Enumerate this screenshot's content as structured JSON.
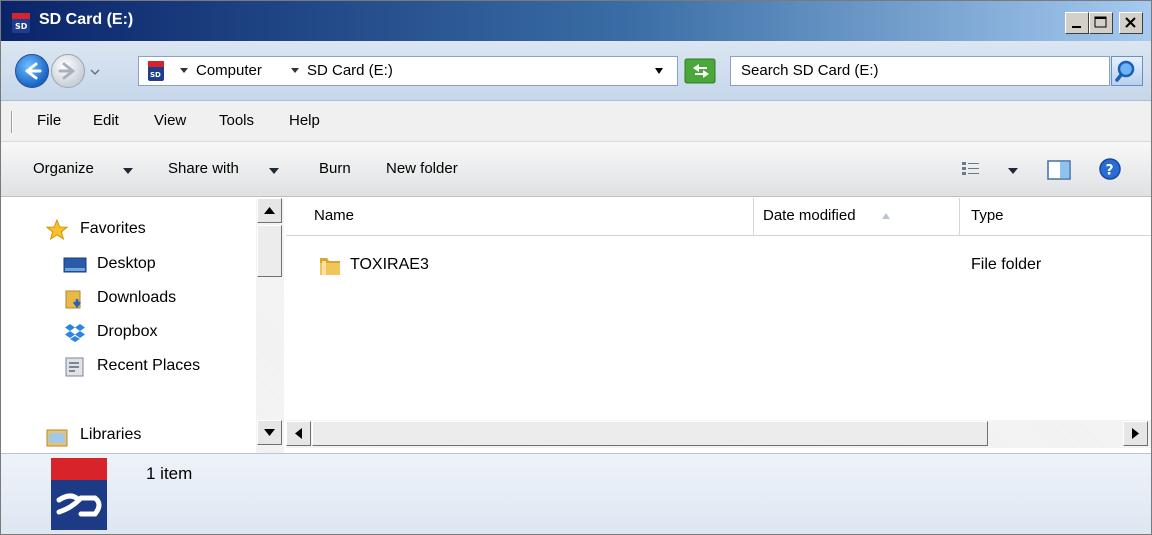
{
  "window": {
    "title": "SD Card (E:)"
  },
  "address_bar": {
    "breadcrumbs": [
      "Computer",
      "SD Card (E:)"
    ],
    "search_placeholder": "Search SD Card (E:)"
  },
  "menu": [
    "File",
    "Edit",
    "View",
    "Tools",
    "Help"
  ],
  "command_bar": {
    "organize": "Organize",
    "share_with": "Share with",
    "burn": "Burn",
    "new_folder": "New folder"
  },
  "nav_pane": {
    "favorites": "Favorites",
    "items": [
      "Desktop",
      "Downloads",
      "Dropbox",
      "Recent Places"
    ],
    "libraries": "Libraries"
  },
  "file_list": {
    "columns": [
      "Name",
      "Date modified",
      "Type"
    ],
    "sort_column": "Date modified",
    "rows": [
      {
        "name": "TOXIRAE3",
        "date_modified": "",
        "type": "File folder"
      }
    ]
  },
  "details": {
    "item_count": "1 item"
  },
  "colors": {
    "title_bar_start": "#0a246a",
    "title_bar_end": "#a6caf0",
    "folder": "#e8b84a"
  }
}
